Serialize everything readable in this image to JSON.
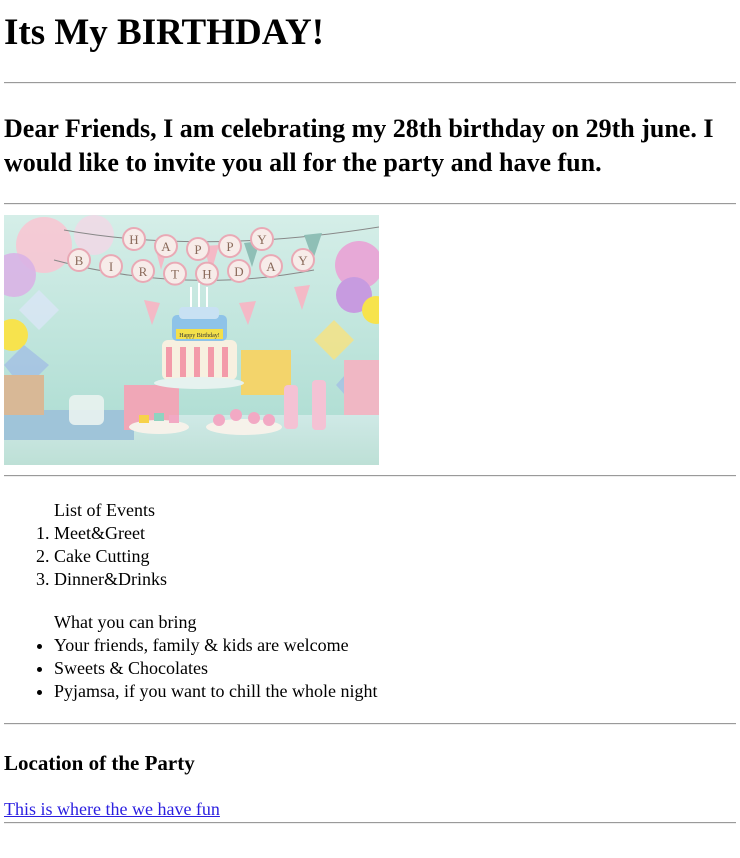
{
  "heading": "Its My BIRTHDAY!",
  "invitation": "Dear Friends, I am celebrating my 28th birthday on 29th june. I would like to invite you all for the party and have fun.",
  "image": {
    "banner_letters_top": [
      "H",
      "A",
      "P",
      "P",
      "Y"
    ],
    "banner_letters_bottom": [
      "B",
      "I",
      "R",
      "T",
      "H",
      "D",
      "A",
      "Y"
    ],
    "cake_label": "Happy Birthday!"
  },
  "events": {
    "caption": "List of Events",
    "items": [
      "Meet&Greet",
      "Cake Cutting",
      "Dinner&Drinks"
    ]
  },
  "bring": {
    "caption": "What you can bring",
    "items": [
      "Your friends, family & kids are welcome",
      "Sweets & Chocolates",
      "Pyjamsa, if you want to chill the whole night"
    ]
  },
  "location": {
    "heading": "Location of the Party",
    "link_text": "This is where the we have fun"
  },
  "colors": {
    "link": "#2a1ee0",
    "rule": "#9a9a9a",
    "backdrop": "#bfe6dd"
  }
}
